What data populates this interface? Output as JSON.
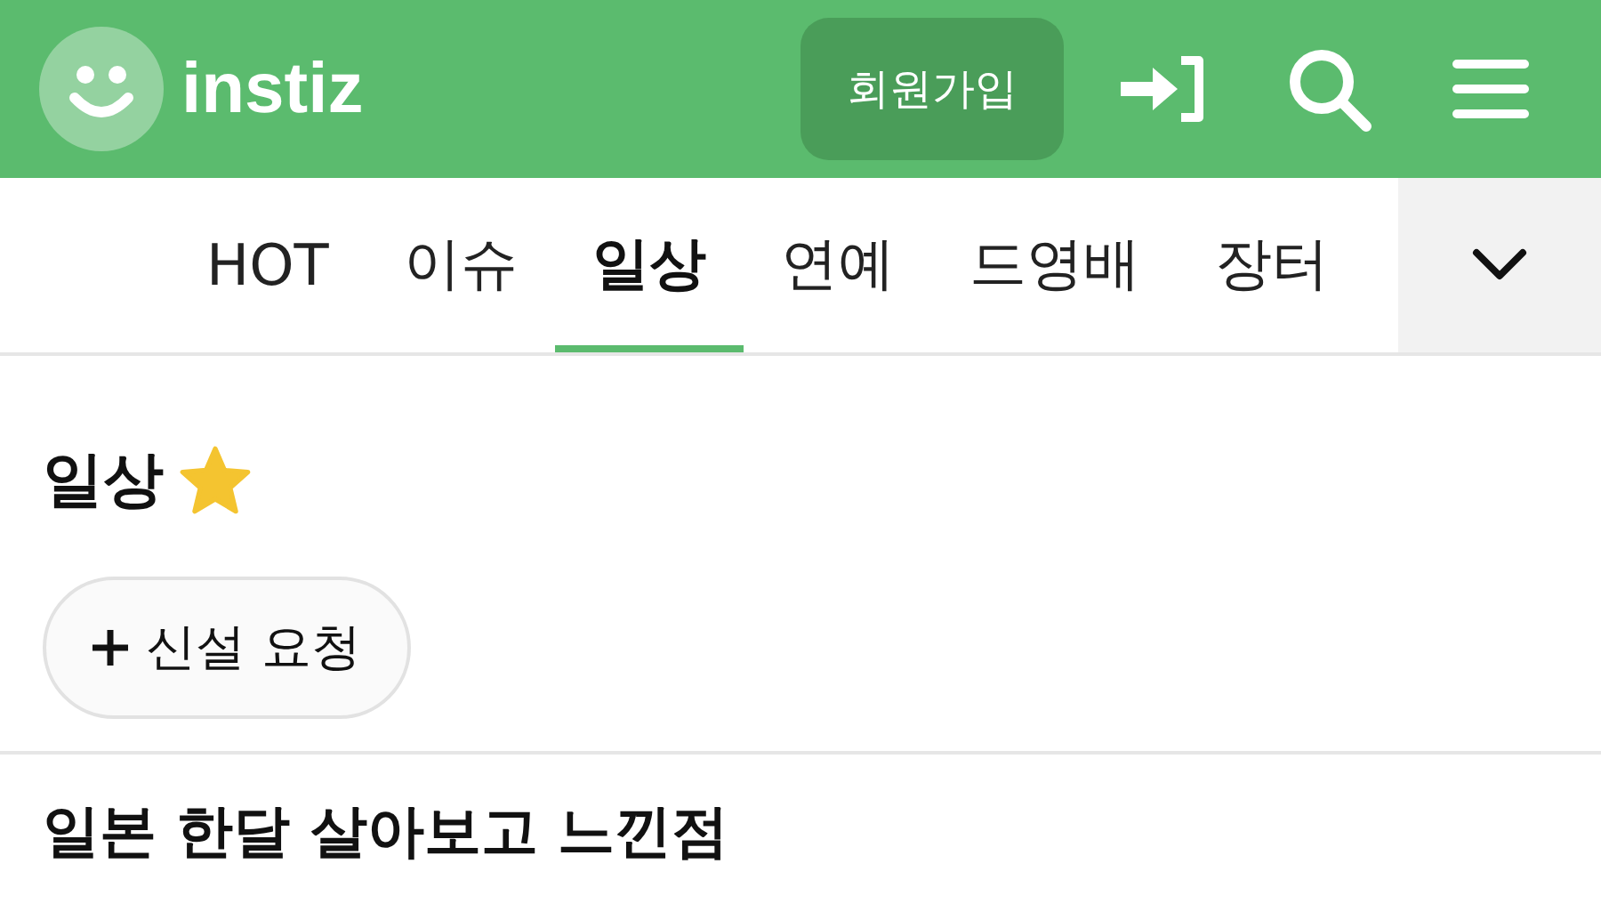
{
  "header": {
    "logo_text": "instiz",
    "signup_button": "회원가입"
  },
  "tabs": [
    {
      "label": "HOT",
      "selected": false
    },
    {
      "label": "이슈",
      "selected": false
    },
    {
      "label": "일상",
      "selected": true
    },
    {
      "label": "연예",
      "selected": false
    },
    {
      "label": "드영배",
      "selected": false
    },
    {
      "label": "장터",
      "selected": false
    }
  ],
  "board": {
    "title": "일상",
    "starred": true,
    "request_button": "신설 요청"
  },
  "posts": [
    {
      "title": "일본 한달 살아보고 느낀점"
    }
  ]
}
